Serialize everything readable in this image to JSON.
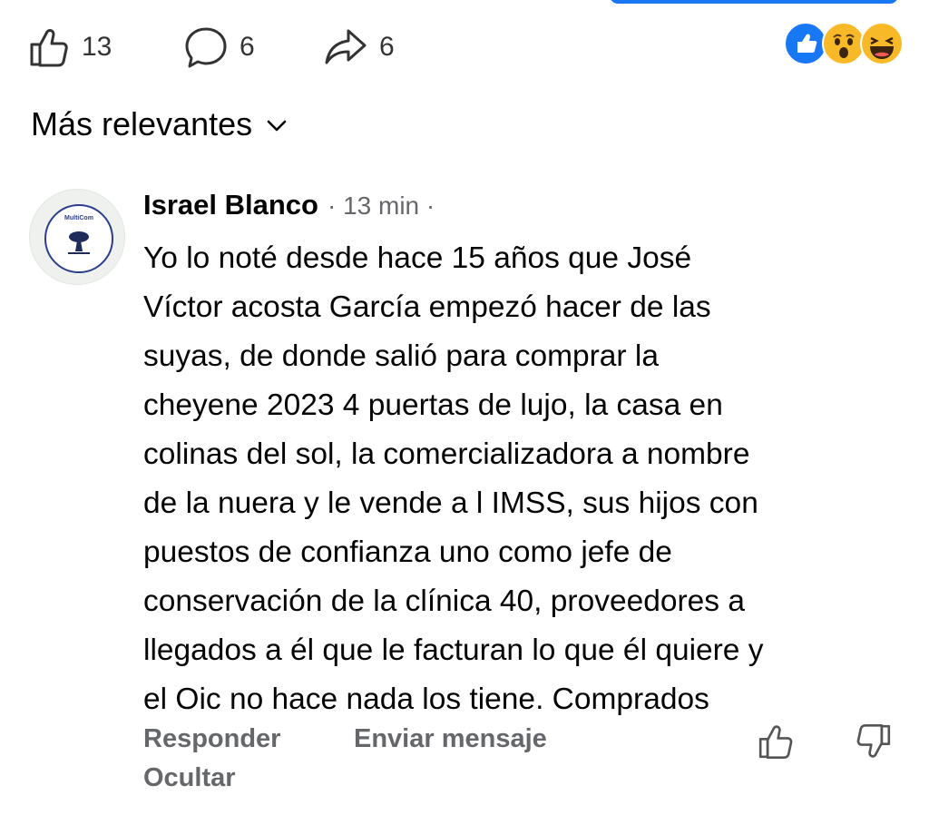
{
  "colors": {
    "accent": "#1877f2",
    "text_primary": "#050505",
    "text_secondary": "#65676b"
  },
  "actions": {
    "like_count": "13",
    "comment_count": "6",
    "share_count": "6"
  },
  "reactions": [
    "like-reaction-icon",
    "wow-reaction-icon",
    "haha-reaction-icon"
  ],
  "sort": {
    "label": "Más relevantes"
  },
  "comment": {
    "avatar_text": "MultiCom",
    "author": "Israel Blanco",
    "meta": "· 13 min ·",
    "lines": [
      "Yo lo noté desde hace 15 años que José",
      "Víctor acosta García empezó hacer de las",
      "suyas, de donde salió para comprar la",
      "cheyene 2023 4 puertas de lujo, la casa en",
      "colinas del sol, la comercializadora a nombre",
      "de la nuera y le vende a l IMSS, sus hijos con",
      "puestos de confianza uno como jefe de",
      "conservación de la clínica 40, proveedores a",
      "llegados a él que le facturan lo que él quiere y",
      "el Oic no hace nada los tiene. Comprados"
    ],
    "reply_label": "Responder",
    "message_label": "Enviar mensaje",
    "hide_label": "Ocultar"
  }
}
